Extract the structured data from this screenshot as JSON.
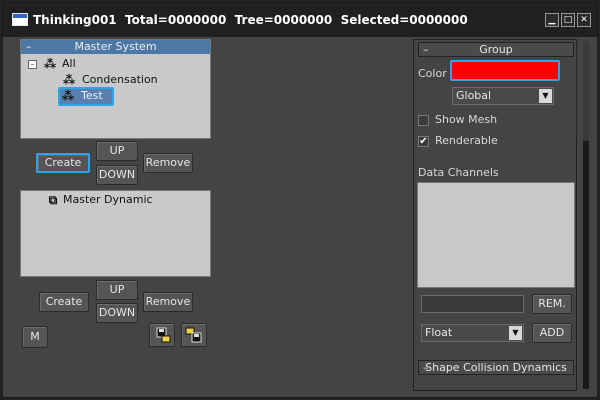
{
  "window": {
    "title": "Thinking001  Total=0000000  Tree=0000000  Selected=0000000",
    "minimize_glyph": "▁",
    "maximize_glyph": "□",
    "close_glyph": "✕"
  },
  "master_system": {
    "header_minus": "–",
    "header_label": "Master System",
    "tree": [
      {
        "label": "All",
        "expander": "–",
        "icon": "node-tree-icon"
      },
      {
        "label": "Condensation",
        "icon": "node-tree-icon"
      },
      {
        "label": "Test",
        "icon": "node-tree-icon",
        "selected": true
      }
    ],
    "buttons": {
      "create": "Create",
      "up": "UP",
      "down": "DOWN",
      "remove": "Remove"
    }
  },
  "master_dynamic": {
    "tree": [
      {
        "label": "Master Dynamic",
        "icon": "dynamic-node-icon"
      }
    ],
    "buttons": {
      "create": "Create",
      "up": "UP",
      "down": "DOWN",
      "remove": "Remove",
      "m": "M"
    }
  },
  "group": {
    "header_minus": "–",
    "header_label": "Group",
    "color_label": "Color",
    "color_value": "#ff0000",
    "scope_selected": "Global",
    "show_mesh_label": "Show Mesh",
    "show_mesh_checked": false,
    "renderable_label": "Renderable",
    "renderable_checked": true,
    "data_channels_label": "Data Channels",
    "rem_button": "REM.",
    "type_selected": "Float",
    "add_button": "ADD",
    "check_glyph": "✔",
    "arrow_glyph": "▼"
  },
  "shape_collision": {
    "header_minus": "–",
    "header_label": "Shape Collision Dynamics"
  },
  "colors": {
    "accent": "#2aa5ea",
    "header_blue": "#4d78a6",
    "panel_bg": "#444444"
  }
}
